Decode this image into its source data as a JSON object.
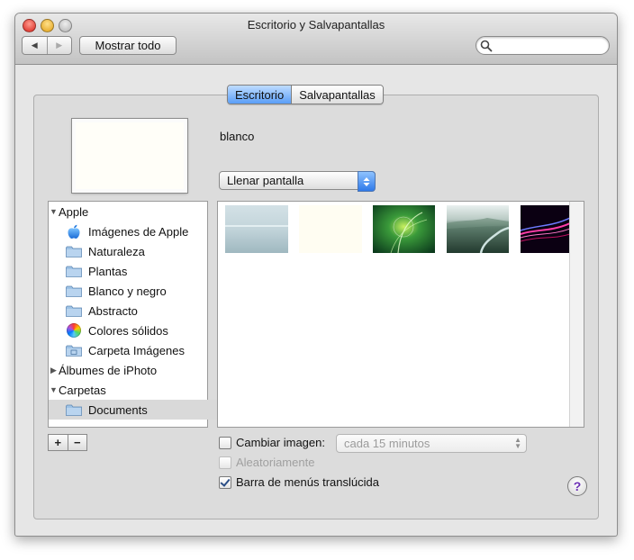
{
  "window": {
    "title": "Escritorio y Salvapantallas"
  },
  "toolbar": {
    "back_label": "◀",
    "forward_label": "▶",
    "show_all_label": "Mostrar todo",
    "search_placeholder": ""
  },
  "tabs": [
    {
      "label": "Escritorio",
      "active": true
    },
    {
      "label": "Salvapantallas",
      "active": false
    }
  ],
  "current": {
    "image_name": "blanco",
    "fit_mode": "Llenar pantalla"
  },
  "sources": [
    {
      "label": "Apple",
      "kind": "group",
      "expanded": true,
      "icon": "disclosure-open-icon"
    },
    {
      "label": "Imágenes de Apple",
      "kind": "item",
      "icon": "apple-logo-icon"
    },
    {
      "label": "Naturaleza",
      "kind": "item",
      "icon": "folder-icon"
    },
    {
      "label": "Plantas",
      "kind": "item",
      "icon": "folder-icon"
    },
    {
      "label": "Blanco y negro",
      "kind": "item",
      "icon": "folder-icon"
    },
    {
      "label": "Abstracto",
      "kind": "item",
      "icon": "folder-icon"
    },
    {
      "label": "Colores sólidos",
      "kind": "item",
      "icon": "color-wheel-icon"
    },
    {
      "label": "Carpeta Imágenes",
      "kind": "item",
      "icon": "pictures-folder-icon"
    },
    {
      "label": "Álbumes de iPhoto",
      "kind": "group",
      "expanded": false,
      "icon": "disclosure-closed-icon"
    },
    {
      "label": "Carpetas",
      "kind": "group",
      "expanded": true,
      "icon": "disclosure-open-icon"
    },
    {
      "label": "Documents",
      "kind": "item",
      "icon": "folder-icon",
      "selected": true
    }
  ],
  "thumbnails": [
    {
      "name": "thumb-pale-sea",
      "colors": [
        "#c9d9de",
        "#a8c0c8"
      ]
    },
    {
      "name": "thumb-white",
      "colors": [
        "#fffef6",
        "#fbf8ea"
      ]
    },
    {
      "name": "thumb-green-aurora",
      "colors": [
        "#2e8a3a",
        "#0d3d1e"
      ]
    },
    {
      "name": "thumb-green-valley",
      "colors": [
        "#7fa69a",
        "#2b4a3d"
      ]
    },
    {
      "name": "thumb-purple-lines",
      "colors": [
        "#120018",
        "#c5187e"
      ]
    }
  ],
  "options": {
    "add_label": "+",
    "remove_label": "−",
    "change_image_label": "Cambiar imagen:",
    "change_image_checked": false,
    "interval_value": "cada 15 minutos",
    "random_label": "Aleatoriamente",
    "random_checked": false,
    "translucent_label": "Barra de menús translúcida",
    "translucent_checked": true,
    "help_label": "?"
  },
  "colors": {
    "tab_active": "#5a9ef7",
    "accent": "#2f79e9"
  }
}
